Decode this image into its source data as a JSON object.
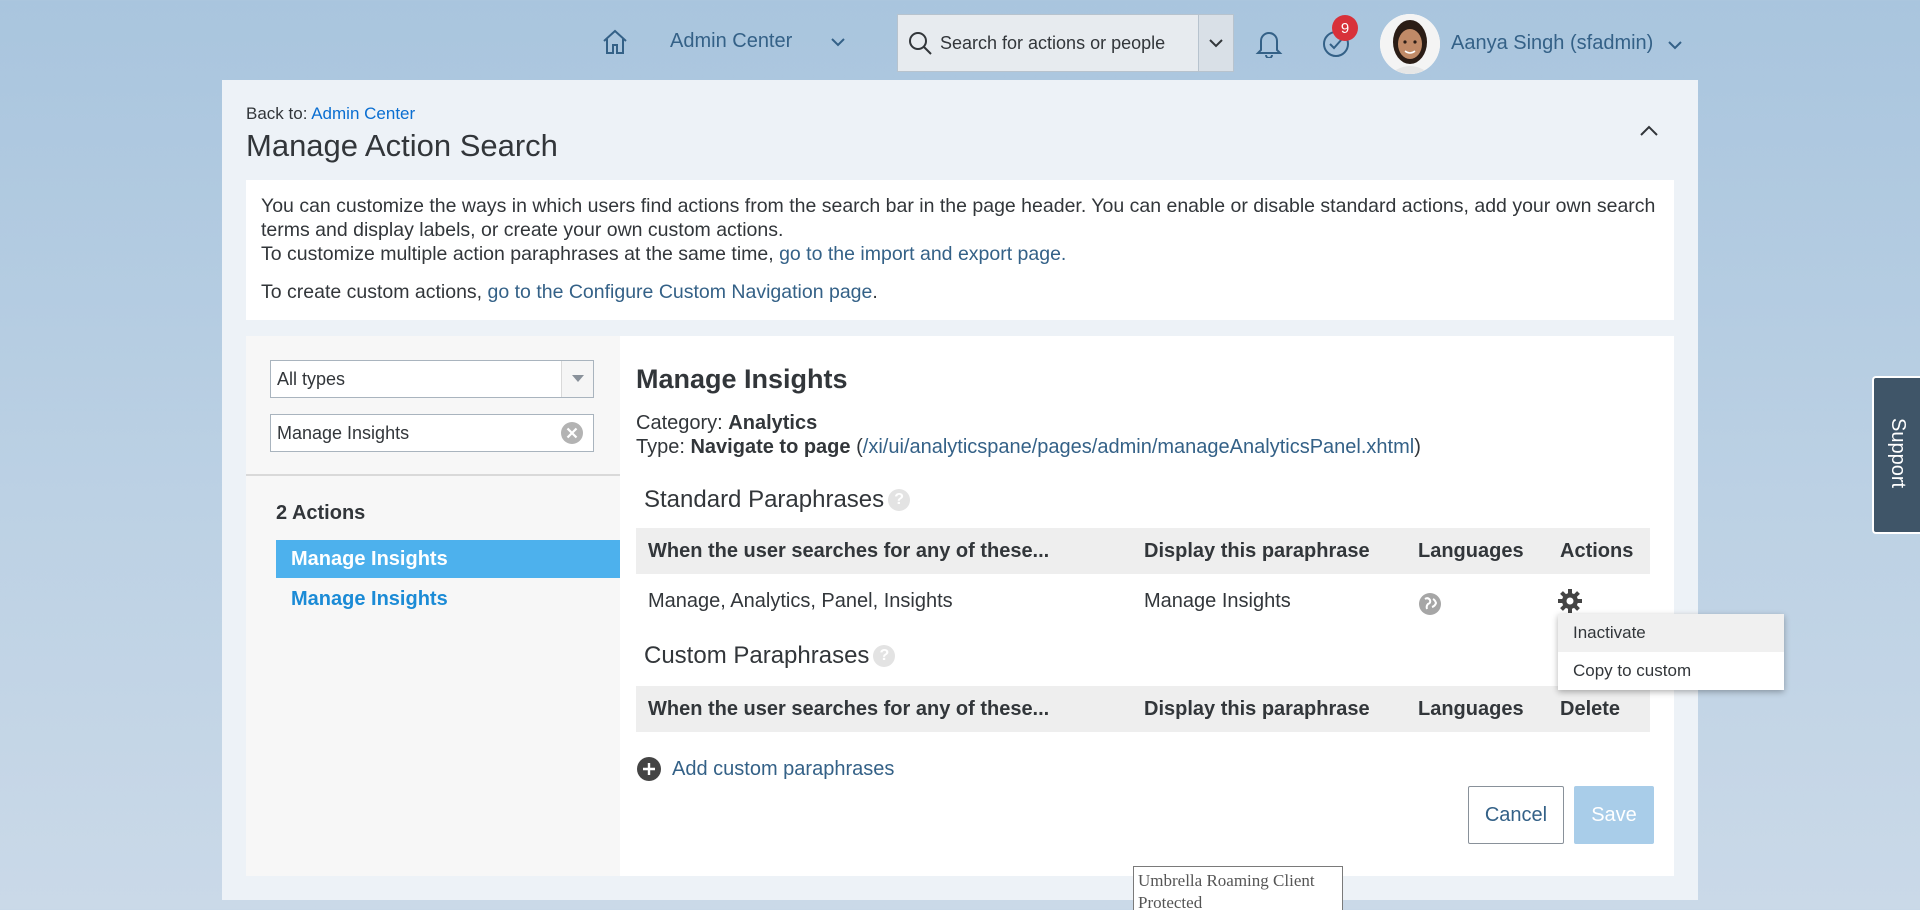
{
  "header": {
    "nav_label": "Admin Center",
    "search_placeholder": "Search for actions or people",
    "notification_count": "9",
    "user_name": "Aanya Singh (sfadmin)"
  },
  "page": {
    "back_prefix": "Back to:",
    "back_link": "Admin Center",
    "title": "Manage Action Search"
  },
  "intro": {
    "line1": "You can customize the ways in which users find actions from the search bar in the page header. You can enable or disable standard actions, add your own search terms and display labels, or create your own custom actions.",
    "line2_prefix": "To customize multiple action paraphrases at the same time,",
    "line2_link": "go to the import and export page.",
    "line3_prefix": "To create custom actions,",
    "line3_link": "go to the Configure Custom Navigation page",
    "line3_suffix": "."
  },
  "filters": {
    "type_select": "All types",
    "search_value": "Manage Insights"
  },
  "results": {
    "count_label": "2 Actions",
    "items": [
      "Manage Insights",
      "Manage Insights"
    ]
  },
  "detail": {
    "title": "Manage Insights",
    "category_label": "Category:",
    "category_value": "Analytics",
    "type_label": "Type:",
    "type_value": "Navigate to page",
    "type_open": "(",
    "type_link": "/xi/ui/analyticspane/pages/admin/manageAnalyticsPanel.xhtml",
    "type_close": ")"
  },
  "standard": {
    "title": "Standard Paraphrases",
    "headers": [
      "When the user searches for any of these...",
      "Display this paraphrase",
      "Languages",
      "Actions"
    ],
    "rows": [
      {
        "terms": "Manage, Analytics, Panel, Insights",
        "paraphrase": "Manage Insights"
      }
    ]
  },
  "custom": {
    "title": "Custom Paraphrases",
    "headers": [
      "When the user searches for any of these...",
      "Display this paraphrase",
      "Languages",
      "Delete"
    ],
    "add_label": "Add custom paraphrases"
  },
  "menu": {
    "items": [
      "Inactivate",
      "Copy to custom"
    ]
  },
  "buttons": {
    "cancel": "Cancel",
    "save": "Save"
  },
  "support_label": "Support",
  "tooltip": "Umbrella Roaming Client Protected",
  "colors": {
    "link": "#346187",
    "selected_item": "#4db1ed",
    "badge": "#d8313a",
    "save_disabled": "#a9cde9"
  }
}
